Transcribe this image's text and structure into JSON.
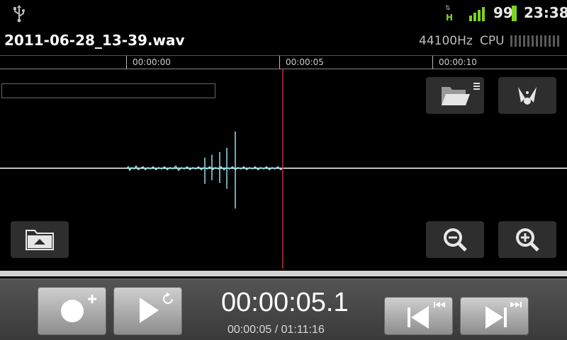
{
  "status": {
    "network_type": "H",
    "network_arrows": "⇅",
    "battery_level": "99",
    "time": "23:38"
  },
  "header": {
    "filename": "2011-06-28_13-39.wav",
    "sample_rate": "44100Hz",
    "cpu_label": "CPU"
  },
  "timeline": {
    "labels": [
      "00:00:00",
      "00:00:05",
      "00:00:10"
    ]
  },
  "playback": {
    "current_time": "00:00:05.1",
    "position_total": "00:00:05 / 01:11:16"
  },
  "colors": {
    "waveform": "#8fe3ee",
    "playhead": "#c0303a",
    "status_green": "#7ed321"
  },
  "icons": {
    "usb": "usb-icon",
    "open_folder": "folder-open-menu-icon",
    "marker": "marker-icon",
    "folder_up": "folder-up-icon",
    "zoom_out": "zoom-out-icon",
    "zoom_in": "zoom-in-icon",
    "record": "record-new-icon",
    "play": "play-repeat-icon",
    "rewind": "skip-back-icon",
    "forward": "skip-forward-icon"
  }
}
